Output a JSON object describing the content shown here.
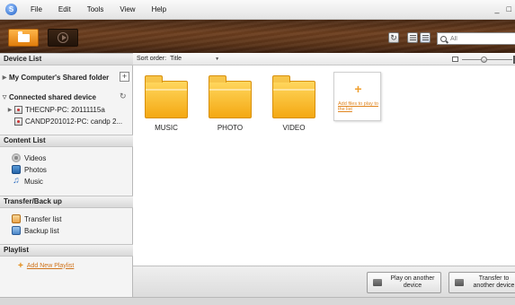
{
  "menu": {
    "logo": "S",
    "items": [
      "File",
      "Edit",
      "Tools",
      "View",
      "Help"
    ],
    "window_controls": [
      "_",
      "□"
    ]
  },
  "toolbar": {
    "search_placeholder": "All",
    "refresh_glyph": "↻"
  },
  "sidebar": {
    "device_list": {
      "title": "Device List",
      "my_computer": "My Computer's Shared folder",
      "add_glyph": "+",
      "connected": "Connected shared device",
      "devices": [
        "THECNP-PC: 20111115a",
        "CANDP201012-PC: candp 2..."
      ]
    },
    "content_list": {
      "title": "Content List",
      "items": [
        "Videos",
        "Photos",
        "Music"
      ]
    },
    "transfer": {
      "title": "Transfer/Back up",
      "items": [
        "Transfer list",
        "Backup list"
      ]
    },
    "playlist": {
      "title": "Playlist",
      "add_label": "Add New Playlist",
      "add_glyph": "+"
    }
  },
  "main": {
    "sort_label": "Sort order:",
    "sort_value": "Title",
    "folders": [
      "MUSIC",
      "PHOTO",
      "VIDEO"
    ],
    "add_files_plus": "+",
    "add_files_label": "Add files to play to the list",
    "play_button": "Play on another device",
    "transfer_button": "Transfer to another device"
  },
  "colors": {
    "accent": "#e38a15",
    "toolbar": "#5a3318",
    "folder": "#f4a812"
  }
}
